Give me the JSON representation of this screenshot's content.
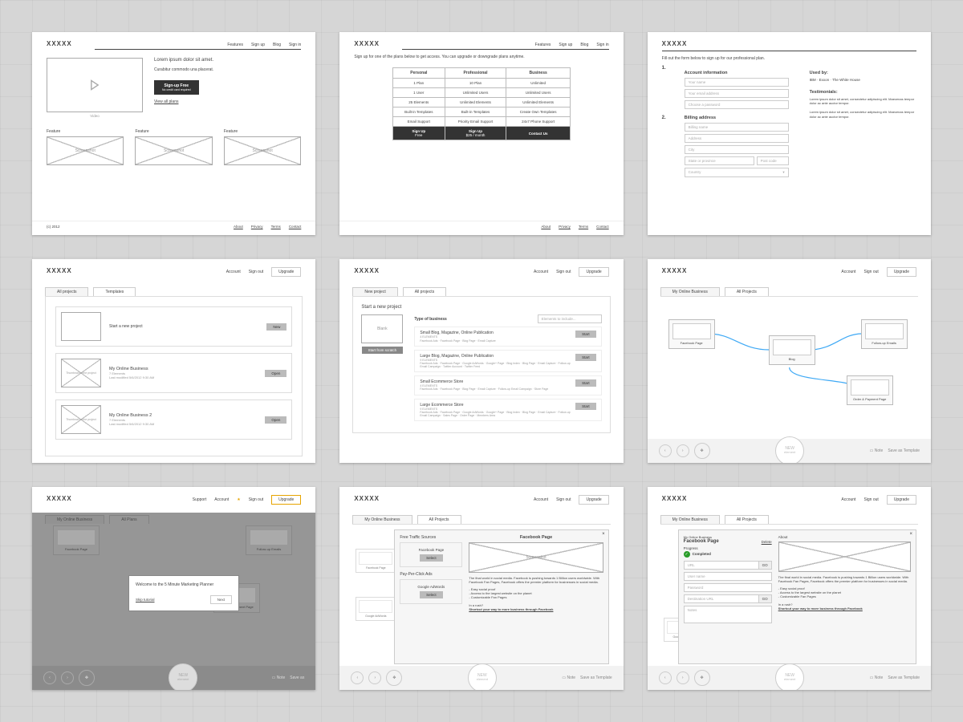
{
  "brand": "XXXXX",
  "nav": {
    "features": "Features",
    "signup": "Sign up",
    "blog": "Blog",
    "signin": "Sign in"
  },
  "footer": {
    "copyright": "(c) 2012",
    "about": "About",
    "privacy": "Privacy",
    "terms": "Terms",
    "contact": "Contact"
  },
  "account_nav": {
    "account": "Account",
    "signout": "Sign out",
    "support": "Support",
    "upgrade": "Upgrade"
  },
  "f1": {
    "headline": "Lorem ipsum dolor sit amet.",
    "subhead": "Curabitur commodo una placerat.",
    "cta": "Sign-up Free",
    "cta_sub": "No credit card required",
    "viewplans": "View all plans",
    "video": "Video",
    "feature_label": "Feature",
    "screenshot": "Screenshot"
  },
  "f2": {
    "intro": "Sign up for one of the plans below to get access. You can upgrade or downgrade plans anytime.",
    "plans": [
      "Personal",
      "Professional",
      "Business"
    ],
    "rows": [
      [
        "1 Plan",
        "10 Plan",
        "Unlimited"
      ],
      [
        "1 User",
        "Unlimited Users",
        "Unlimited Users"
      ],
      [
        "25 Elements",
        "Unlimited Elements",
        "Unlimited Elements"
      ],
      [
        "Built-in Templates",
        "Built-in Templates",
        "Create Own Templates"
      ],
      [
        "Email Support",
        "Priority Email Support",
        "24x7 Phone Support"
      ]
    ],
    "actions": [
      {
        "top": "Sign Up",
        "bot": "Free"
      },
      {
        "top": "Sign Up",
        "bot": "$25 / month"
      },
      {
        "top": "Contact Us",
        "bot": ""
      }
    ]
  },
  "f3": {
    "intro": "Fill out the form below to sign up for our professional plan.",
    "s1": "Account information",
    "s2": "Billing address",
    "p_name": "Your name",
    "p_email": "Your email address",
    "p_pwd": "Choose a password",
    "p_bill": "Billing name",
    "p_addr": "Address",
    "p_city": "City",
    "p_state": "State or province",
    "p_zip": "Post code",
    "p_country": "Country",
    "usedby_h": "Used by:",
    "usedby": "IBM · Exxon · The White House",
    "test_h": "Testimonials:",
    "test": "Lorem ipsum dolor sit amet, consectetur adipiscing elit. Maecenas tempor dolor ac ante auctor tempor."
  },
  "f4": {
    "tab_all": "All projects",
    "tab_tpl": "Templates",
    "start": "Start a new project",
    "new": "New",
    "p1_name": "My Online Business",
    "p1_meta": "7 Elements\nLast modified 5/6/2012 9:30 AM",
    "p2_name": "My Online Business 2",
    "p2_meta": "7 Elements\nLast modified 5/6/2012 9:30 AM",
    "open": "Open",
    "thumb": "Thumbnail of the project"
  },
  "f5": {
    "tab_new": "New project",
    "tab_all": "All projects",
    "heading": "Start a new project",
    "blank": "Blank",
    "scratch": "Start from scratch",
    "type_h": "Type of business",
    "search_ph": "Elements to include...",
    "items": [
      {
        "t": "Small Blog, Magazine, Online Publication",
        "sub": "4 ELEMENTS\nFacebook Ads · Facebook Page · Blog Page · Email Capture"
      },
      {
        "t": "Large Blog, Magazine, Online Publication",
        "sub": "9 ELEMENTS\nFacebook Ads · Facebook Page · Google AdWords · Google+ Page · Blog Index · Blog Page · Email Capture · Follow-up Email Campaign · Twitter Account · Twitter Feed"
      },
      {
        "t": "Small Ecommerce Store",
        "sub": "4 ELEMENTS\nFacebook Ads · Facebook Page · Blog Page · Email Capture · Follow-up Email Campaign · Store Page"
      },
      {
        "t": "Large Ecommerce Store",
        "sub": "9 ELEMENTS\nFacebook Ads · Facebook Page · Google AdWords · Google+ Page · Blog Index · Blog Page · Email Capture · Follow-up Email Campaign · Sales Page · Order Page · Members Area"
      }
    ],
    "start": "Start"
  },
  "f6": {
    "tab_my": "My Online Business",
    "tab_all": "All Projects",
    "nodes": {
      "fb": "Facebook Page",
      "blog": "Blog",
      "emails": "Follow-up Emails",
      "order": "Order & Payment Page"
    },
    "bottom": {
      "new": "NEW",
      "element": "element",
      "note": "Note",
      "save": "Save as Template"
    }
  },
  "f7": {
    "tab_my": "My Online Business",
    "tab_all": "All Plans",
    "welcome": "Welcome to the 5 Minute Marketing Planner",
    "skip": "Skip tutorial",
    "next": "Next",
    "save": "Save as"
  },
  "f8": {
    "tab_my": "My Online Business",
    "tab_all": "All Projects",
    "free_h": "Free Traffic Sources",
    "ppc_h": "Pay-Per-Click Ads",
    "fb_label": "Facebook Page",
    "aw_label": "Google AdWords",
    "select": "Select",
    "detail_h": "Facebook Page",
    "screenshot": "Screenshot",
    "para": "The final world in social media. Facebook is pushing towards 1 Billion users worldwide. With Facebook Fan Pages, Facebook offers the premier platform for businesses in social media.",
    "b1": "- Easy social proof",
    "b2": "- Access to the largest website on the planet",
    "b3": "- Customizable Fan Pages",
    "rush": "In a rush?",
    "shortcut": "Shortcut your way to more business through Facebook",
    "save": "Save as Template"
  },
  "f9": {
    "tab_my": "My Online Business",
    "tab_all": "All Projects",
    "crumb": "My Online Business",
    "title": "Facebook Page",
    "delete": "Delete",
    "about": "About",
    "progress": "Progress",
    "completed": "Completed",
    "p_url": "URL",
    "p_user": "User name",
    "p_pwd": "Password",
    "p_dest": "Destination URL",
    "p_notes": "Notes",
    "go": "GO",
    "para": "The final world in social media. Facebook is pushing towards 1 Billion users worldwide. With Facebook Fan Pages, Facebook offers the premier platform for businesses in social media.",
    "b1": "- Easy social proof",
    "b2": "- Access to the largest website on the planet",
    "b3": "- Customizable Fan Pages",
    "rush": "In a rush?",
    "shortcut": "Shortcut your way to more business through Facebook"
  }
}
